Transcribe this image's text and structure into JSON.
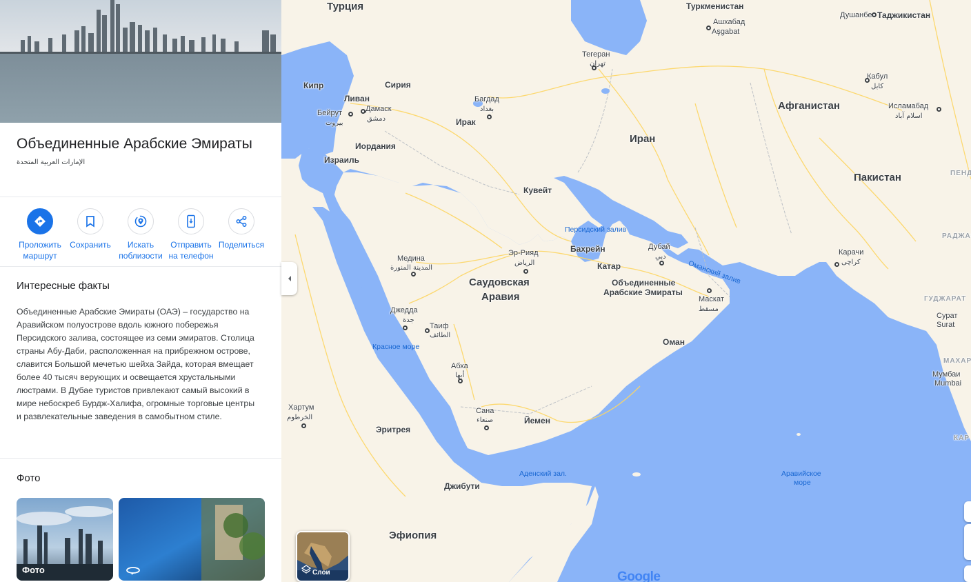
{
  "colors": {
    "accent": "#1a73e8",
    "water": "#aecbfa",
    "land": "#f8f3e8",
    "road": "#fdd663"
  },
  "place": {
    "title": "Объединенные Арабские Эмираты",
    "subtitle": "الإمارات العربية المتحدة"
  },
  "actions": [
    {
      "label": "Проложить маршрут",
      "icon": "directions-icon"
    },
    {
      "label": "Сохранить",
      "icon": "bookmark-icon"
    },
    {
      "label": "Искать поблизости",
      "icon": "nearby-icon"
    },
    {
      "label": "Отправить на телефон",
      "icon": "send-to-phone-icon"
    },
    {
      "label": "Поделиться",
      "icon": "share-icon"
    }
  ],
  "facts": {
    "heading": "Интересные факты",
    "text": "Объединенные Арабские Эмираты (ОАЭ) – государство на Аравийском полуострове вдоль южного побережья Персидского залива, состоящее из семи эмиратов. Столица страны Абу-Даби, расположенная на прибрежном острове, славится Большой мечетью шейха Зайда, которая вмещает более 40 тысяч верующих и освещается хрустальными люстрами. В Дубае туристов привлекают самый высокий в мире небоскреб Бурдж-Халифа, огромные торговые центры и развлекательные заведения в самобытном стиле."
  },
  "photos": {
    "heading": "Фото",
    "first_caption": "Фото"
  },
  "map": {
    "layers_label": "Слои",
    "logo": "Google",
    "countries": {
      "turkey": "Турция",
      "turkmenistan": "Туркменистан",
      "tajikistan": "Таджикистан",
      "cyprus": "Кипр",
      "syria": "Сирия",
      "lebanon": "Ливан",
      "jordan": "Иордания",
      "israel": "Израиль",
      "iraq": "Ирак",
      "iran": "Иран",
      "afghanistan": "Афганистан",
      "pakistan": "Пакистан",
      "kuwait": "Кувейт",
      "bahrain": "Бахрейн",
      "qatar": "Катар",
      "uae_1": "Объединенные",
      "uae_2": "Арабские Эмираты",
      "saudi_1": "Саудовская",
      "saudi_2": "Аравия",
      "oman": "Оман",
      "yemen": "Йемен",
      "eritrea": "Эритрея",
      "djibouti": "Джибути",
      "ethiopia": "Эфиопия"
    },
    "cities": {
      "dushanbe": "Душанбе",
      "ashgabat_ru": "Ашхабад",
      "ashgabat": "Aşgabat",
      "tehran_ru": "Тегеран",
      "tehran": "تهران",
      "kabul_ru": "Кабул",
      "kabul": "کابل",
      "islamabad_ru": "Исламабад",
      "islamabad": "اسلام آباد",
      "damascus_ru": "Дамаск",
      "damascus": "دمشق",
      "beirut_ru": "Бейрут",
      "beirut": "بيروت",
      "baghdad_ru": "Багдад",
      "baghdad": "بغداد",
      "riyadh_ru": "Эр-Рияд",
      "riyadh": "الرياض",
      "medina_ru": "Медина",
      "medina": "المدينة المنورة",
      "jeddah_ru": "Джедда",
      "jeddah": "جدة",
      "taif_ru": "Таиф",
      "taif": "الطائف",
      "abha_ru": "Абха",
      "abha": "أبها",
      "sanaa_ru": "Сана",
      "sanaa": "صنعاء",
      "dubai_ru": "Дубай",
      "dubai": "دبي",
      "muscat_ru": "Маскат",
      "muscat": "مسقط",
      "karachi_ru": "Карачи",
      "karachi": "کراچی",
      "surat_ru": "Сурат",
      "surat": "Surat",
      "mumbai_ru": "Мумбаи",
      "mumbai": "Mumbai",
      "khartoum_ru": "Хартум",
      "khartoum": "الخرطوم"
    },
    "water": {
      "persian_gulf": "Персидский залив",
      "oman_gulf": "Оманский залив",
      "red_sea": "Красное море",
      "aden_gulf": "Аденский зал.",
      "arabian_sea_1": "Аравийское",
      "arabian_sea_2": "море"
    },
    "regions": {
      "rajasthan": "РАДЖАСТА",
      "gujarat": "ГУДЖАРАТ",
      "maharashtra": "МАХАРАШ",
      "pend": "ПЕНДЖ",
      "kar": "КАР"
    }
  }
}
